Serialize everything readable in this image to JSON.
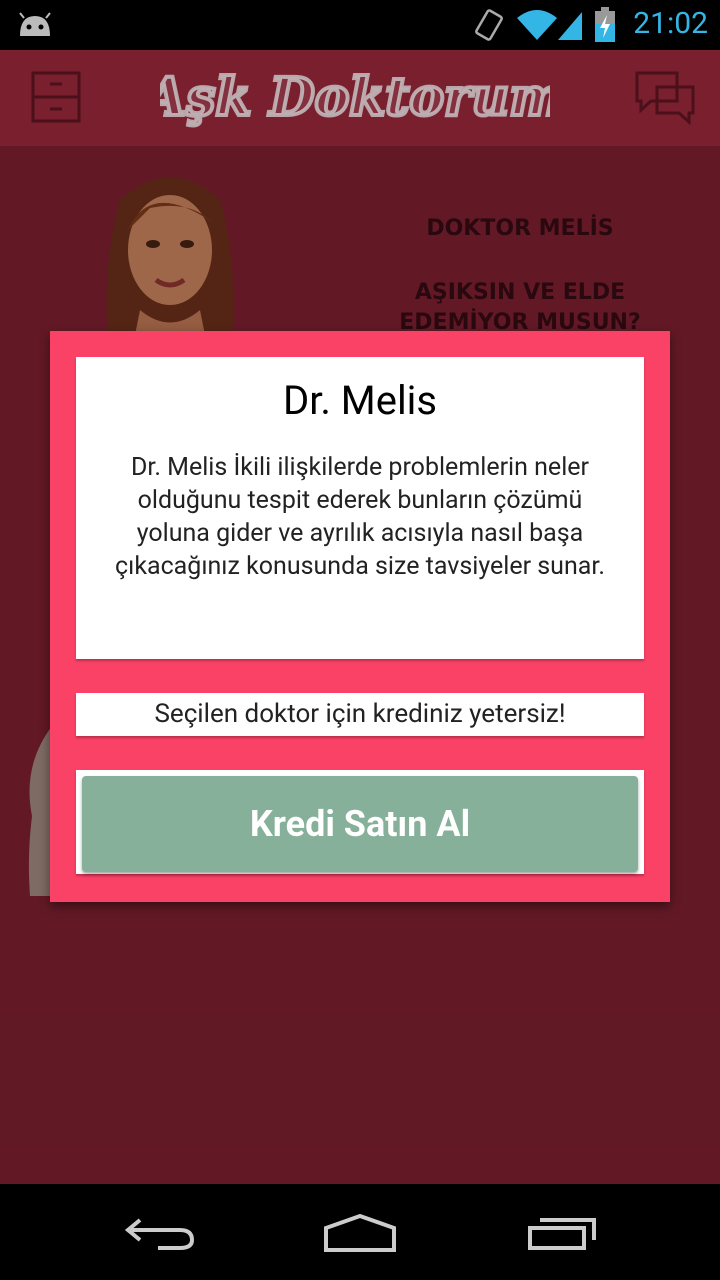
{
  "status_bar": {
    "time": "21:02"
  },
  "app_bar": {
    "logo_text": "Aşk Doktorum"
  },
  "background": {
    "doctor_name": "DOKTOR MELİS",
    "tagline": "AŞIKSIN VE ELDE EDEMİYOR MUSUN?"
  },
  "dialog": {
    "title": "Dr. Melis",
    "description": "Dr. Melis İkili ilişkilerde problemlerin neler olduğunu tespit ederek bunların çözümü yoluna gider ve ayrılık acısıyla nasıl başa çıkacağınız konusunda size  tavsiyeler sunar.",
    "message": "Seçilen doktor için krediniz yetersiz!",
    "buy_button_label": "Kredi Satın Al"
  },
  "colors": {
    "background": "#6a1d2a",
    "dialog_border": "#fa4166",
    "buy_button": "#86b09a",
    "status_time": "#33b5e5"
  }
}
